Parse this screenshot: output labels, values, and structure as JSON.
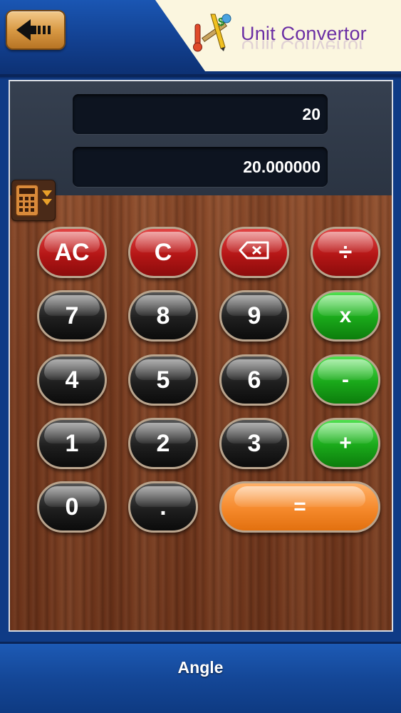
{
  "header": {
    "title": "Unit Convertor",
    "back_icon": "back-arrow-icon",
    "logo_icon": "unit-convertor-logo-icon"
  },
  "display": {
    "input_value": "20",
    "output_value": "20.000000"
  },
  "keypad": {
    "rows": [
      [
        "AC",
        "C",
        "⌫",
        "÷"
      ],
      [
        "7",
        "8",
        "9",
        "x"
      ],
      [
        "4",
        "5",
        "6",
        "-"
      ],
      [
        "1",
        "2",
        "3",
        "+"
      ],
      [
        "0",
        ".",
        "="
      ]
    ]
  },
  "footer": {
    "title": "Angle"
  },
  "colors": {
    "header_blue": "#1a56b3",
    "logo_bg": "#fbf6df",
    "logo_text": "#6b2fa4",
    "key_red": "#b51616",
    "key_black": "#1f1f1f",
    "key_green": "#1aa81a",
    "key_orange": "#f5892b"
  }
}
